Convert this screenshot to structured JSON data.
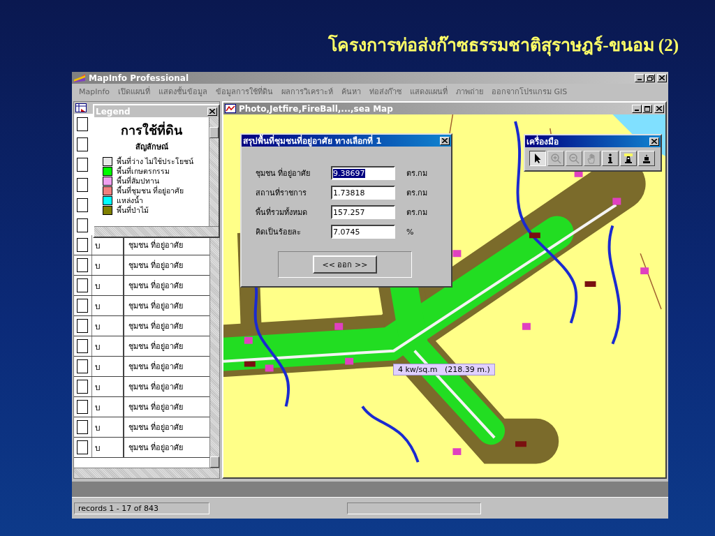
{
  "slide_title": "โครงการท่อส่งก๊าซธรรมชาติสุราษฎร์-ขนอม (2)",
  "window": {
    "title": "MapInfo Professional"
  },
  "menu": [
    "MapInfo",
    "เปิดแผนที่",
    "แสดงชั้นข้อมูล",
    "ข้อมูลการใช้ที่ดิน",
    "ผลการวิเคราะห์",
    "ค้นหา",
    "ท่อส่งก๊าซ",
    "แสดงแผนที่",
    "ภาพถ่าย",
    "ออกจากโปรแกรม GIS"
  ],
  "browser": {
    "rows": [
      {
        "kind": "covered",
        "selected": false
      },
      {
        "kind": "covered",
        "selected": false
      },
      {
        "kind": "covered",
        "selected": false
      },
      {
        "kind": "covered",
        "selected": false
      },
      {
        "kind": "covered",
        "selected": false
      },
      {
        "kind": "covered",
        "selected": false
      },
      {
        "kind": "record",
        "code": "บ",
        "name": "ชุมชน ที่อยู่อาศัย",
        "selected": false
      },
      {
        "kind": "record",
        "code": "บ",
        "name": "ชุมชน ที่อยู่อาศัย",
        "selected": false
      },
      {
        "kind": "record",
        "code": "บ",
        "name": "ชุมชน ที่อยู่อาศัย",
        "selected": false
      },
      {
        "kind": "record",
        "code": "บ",
        "name": "ชุมชน ที่อยู่อาศัย",
        "selected": false
      },
      {
        "kind": "record",
        "code": "บ",
        "name": "ชุมชน ที่อยู่อาศัย",
        "selected": false
      },
      {
        "kind": "record",
        "code": "บ",
        "name": "ชุมชน ที่อยู่อาศัย",
        "selected": false
      },
      {
        "kind": "record",
        "code": "บ",
        "name": "ชุมชน ที่อยู่อาศัย",
        "selected": false
      },
      {
        "kind": "record",
        "code": "บ",
        "name": "ชุมชน ที่อยู่อาศัย",
        "selected": false
      },
      {
        "kind": "record",
        "code": "บ",
        "name": "ชุมชน ที่อยู่อาศัย",
        "selected": false
      },
      {
        "kind": "record",
        "code": "บ",
        "name": "ชุมชน ที่อยู่อาศัย",
        "selected": false
      },
      {
        "kind": "record",
        "code": "บ",
        "name": "ชุมชน ที่อยู่อาศัย",
        "selected": false
      }
    ]
  },
  "legend": {
    "title": "Legend",
    "heading": "การใช้ที่ดิน",
    "subheading": "สัญลักษณ์",
    "items": [
      {
        "label": "พื้นที่ว่าง ไม่ใช้ประโยชน์",
        "color": "#e8e8e8"
      },
      {
        "label": "พื้นที่เกษตรกรรม",
        "color": "#00ff00"
      },
      {
        "label": "พื้นที่สัมปทาน",
        "color": "#f0a0f0"
      },
      {
        "label": "พื้นที่ชุมชน ที่อยู่อาศัย",
        "color": "#f08080"
      },
      {
        "label": "แหล่งน้ำ",
        "color": "#00ffff"
      },
      {
        "label": "พื้นที่ป่าไม้",
        "color": "#808000"
      }
    ]
  },
  "map_window": {
    "title": "Photo,Jetfire,FireBall,...,sea Map",
    "ruler_tooltip": "4 kw/sq.m   (218.39 m.)"
  },
  "dialog": {
    "title": "สรุปพื้นที่ชุมชนที่อยู่อาศัย ทางเลือกที่ 1",
    "fields": [
      {
        "label": "ชุมชน ที่อยู่อาศัย",
        "value": "9.38697",
        "unit": "ตร.กม",
        "selected": true
      },
      {
        "label": "สถานที่ราชการ",
        "value": "1.73818",
        "unit": "ตร.กม",
        "selected": false
      },
      {
        "label": "พื้นที่รวมทั้งหมด",
        "value": "157.257",
        "unit": "ตร.กม",
        "selected": false
      },
      {
        "label": "คิดเป็นร้อยละ",
        "value": "7.0745",
        "unit": "%",
        "selected": false
      }
    ],
    "button": "<< ออก >>"
  },
  "toolbar": {
    "title": "เครื่องมือ",
    "tools": [
      {
        "kind": "pointer",
        "selected": true,
        "disabled": false
      },
      {
        "kind": "zoom-in",
        "selected": false,
        "disabled": true
      },
      {
        "kind": "zoom-out",
        "selected": false,
        "disabled": true
      },
      {
        "kind": "hand",
        "selected": false,
        "disabled": true
      },
      {
        "kind": "info",
        "selected": false,
        "disabled": false
      },
      {
        "kind": "lighthouse",
        "selected": false,
        "disabled": false
      },
      {
        "kind": "marker",
        "selected": false,
        "disabled": false
      }
    ]
  },
  "status_bar": {
    "records": "records 1 - 17 of 843"
  }
}
